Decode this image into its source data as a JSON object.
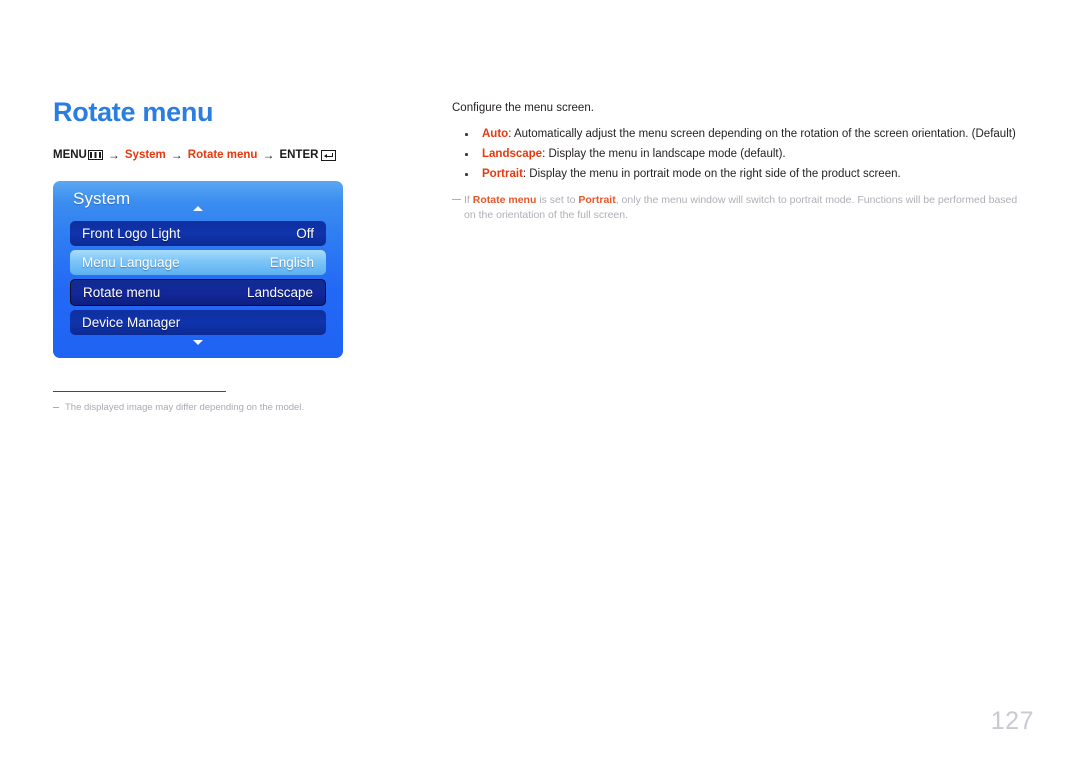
{
  "page": {
    "title": "Rotate menu",
    "number": "127"
  },
  "menu_path": {
    "menu_label": "MENU",
    "menu_icon": "menu-grid-icon",
    "arrow": "→",
    "step1": "System",
    "step2": "Rotate menu",
    "enter_label": "ENTER",
    "enter_icon": "enter-return-icon"
  },
  "osd": {
    "title": "System",
    "scroll_up_icon": "chevron-up-icon",
    "scroll_down_icon": "chevron-down-icon",
    "rows": [
      {
        "label": "Front Logo Light",
        "value": "Off",
        "state": "normal"
      },
      {
        "label": "Menu Language",
        "value": "English",
        "state": "highlight"
      },
      {
        "label": "Rotate menu",
        "value": "Landscape",
        "state": "selected"
      },
      {
        "label": "Device Manager",
        "value": "",
        "state": "normal"
      }
    ]
  },
  "left_footnote": {
    "text": "The displayed image may differ depending on the model."
  },
  "description": {
    "intro": "Configure the menu screen.",
    "bullets": [
      {
        "term": "Auto",
        "text": ": Automatically adjust the menu screen depending on the rotation of the screen orientation. (Default)"
      },
      {
        "term": "Landscape",
        "text": ": Display the menu in landscape mode (default)."
      },
      {
        "term": "Portrait",
        "text": ": Display the menu in portrait mode on the right side of the product screen."
      }
    ],
    "note": {
      "part1": "If ",
      "term1": "Rotate menu",
      "part2": " is set to ",
      "term2": "Portrait",
      "part3": ", only the menu window will switch to portrait mode. Functions will be performed based on the orientation of the full screen."
    }
  },
  "colors": {
    "title_blue": "#2a7de1",
    "accent_red": "#e8380d",
    "osd_blue": "#2368f5",
    "osd_row_dark": "#0d2f9e",
    "osd_row_highlight": "#7cc5f7",
    "footnote_gray": "#a9a9b4"
  }
}
